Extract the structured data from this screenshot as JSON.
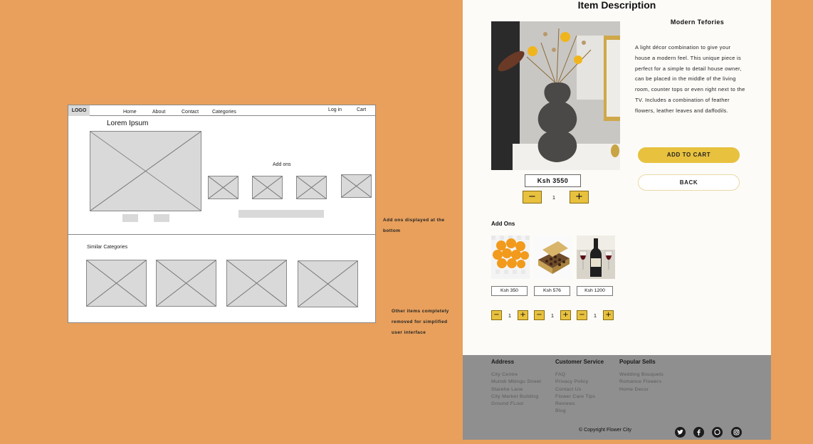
{
  "wireframe": {
    "logo": "LOGO",
    "nav": [
      "Home",
      "About",
      "Contact",
      "Categories"
    ],
    "login": "Log in",
    "cart": "Cart",
    "title": "Lorem Ipsum",
    "addons_label": "Add ons",
    "similar_label": "Similar Categories"
  },
  "notes": {
    "addons_note_1": "Add ons displayed at the",
    "addons_note_2": "bottom",
    "other_note_1": "Other items completely",
    "other_note_2": "removed for simplified",
    "other_note_3": "user interface"
  },
  "product": {
    "page_title": "Item Description",
    "name": "Modern Tefories",
    "description": "A light décor combination to give your house a modern feel. This unique piece is perfect for a simple to detail house owner, can be placed in the middle of the living room, counter tops or even right next to the TV. Includes a combination of feather flowers, leather leaves and daffodils.",
    "price": "Ksh 3550",
    "quantity": "1",
    "add_to_cart": "ADD TO CART",
    "back": "BACK",
    "minus": "−",
    "plus": "+"
  },
  "addons": {
    "title": "Add Ons",
    "items": [
      {
        "image": "orange-balloons",
        "price": "Ksh 350",
        "quantity": "1"
      },
      {
        "image": "chocolate-box",
        "price": "Ksh 576",
        "quantity": "1"
      },
      {
        "image": "wine-bottle",
        "price": "Ksh 1200",
        "quantity": "1"
      }
    ]
  },
  "footer": {
    "address": {
      "title": "Address",
      "lines": [
        "City Centre",
        "Muindi Mbingu Street",
        "Starehe Lane",
        "City Market Building",
        "Ground FLoor"
      ]
    },
    "service": {
      "title": "Customer Service",
      "lines": [
        "FAQ",
        "Privacy Policy",
        "Contact Us",
        "Flower Care Tips",
        "Reviews",
        "Blog"
      ]
    },
    "popular": {
      "title": "Popular Sells",
      "lines": [
        "Wedding Bouquets",
        "Romance Flowers",
        "Home Decor"
      ]
    },
    "copyright": "© Copyright  Flower City",
    "social": [
      "twitter-icon",
      "facebook-icon",
      "whatsapp-icon",
      "instagram-icon"
    ]
  },
  "colors": {
    "background": "#E8A05C",
    "accent": "#E8C13E",
    "footer": "#8f8f8f",
    "page": "#fcfbf8"
  }
}
